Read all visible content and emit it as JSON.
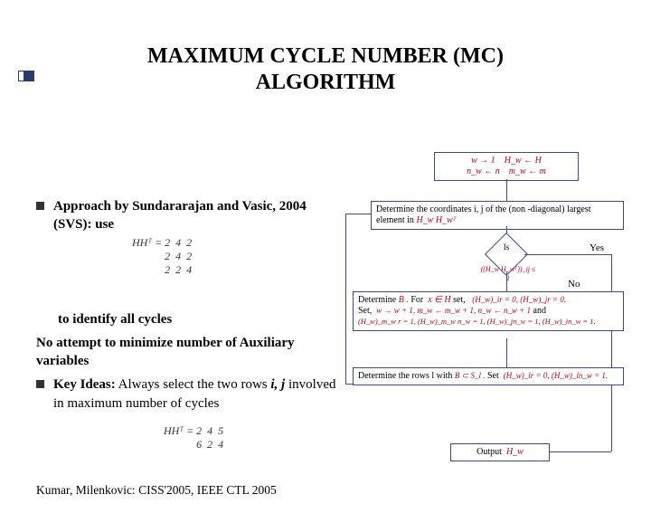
{
  "title_line1": "MAXIMUM CYCLE NUMBER (MC)",
  "title_line2": "ALGORITHM",
  "bullets": {
    "b1_prefix": "Approach by Sundararajan and Vasic, 2004 (SVS): use",
    "b2_text": "to identify all cycles",
    "b3_text": "No attempt to minimize number of Auxiliary variables",
    "b4_prefix": "Key Ideas:",
    "b4_rest": " Always select the two rows ",
    "b4_ij": "i, j",
    "b4_tail": " involved in maximum number of cycles"
  },
  "matrix1_label": "HHᵀ =",
  "matrix1_rows": "2  4  2\n2  4  2\n2  2  4",
  "matrix2_label": "HHᵀ =",
  "matrix2_rows": "2  4  5\n6  2  4",
  "footer": "Kumar, Milenkovic: CISS'2005, IEEE CTL 2005",
  "flow": {
    "init": {
      "w1": "w → 1",
      "hwh": "H_w ← H",
      "nw": "n_w ← n",
      "mw": "m_w ← m"
    },
    "step1": "Determine the coordinates i, j of the  (non -diagonal) largest element in",
    "step1_math": "H_w H_wᵀ",
    "diamond_top": "Is",
    "diamond_cond": "((H_w H_wᵀ))_ij ≤ 1",
    "yes": "Yes",
    "no": "No",
    "det_b": "Determine",
    "det_b_math": "B .",
    "for_x": " For",
    "for_x_math": "x ∈ H",
    "xset": "set,",
    "bset_math": "(H_w)_ir = 0, (H_w)_jr = 0.",
    "set_line": "Set,",
    "set_math": "w → w + 1, m_w ← m_w + 1, n_w ← n_w + 1",
    "and": " and",
    "set_math2": "(H_w)_m_w r = 1, (H_w)_m_w n_w = 1, (H_w)_jn_w = 1, (H_w)_in_w = 1.",
    "rows_l": "Determine the rows l with",
    "rows_l_math": "B ⊂ S_l .",
    "rows_set": " Set",
    "rows_set_math": "(H_w)_lr = 0, (H_w)_ln_w = 1.",
    "output": "Output",
    "output_math": "H_w"
  }
}
